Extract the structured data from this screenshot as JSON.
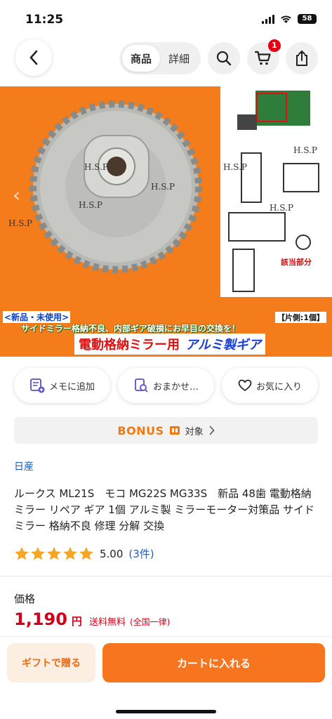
{
  "status": {
    "time": "11:25",
    "battery": "58"
  },
  "header": {
    "tabs": [
      {
        "label": "商品"
      },
      {
        "label": "詳細"
      }
    ],
    "cart_count": "1"
  },
  "hero": {
    "watermark": "H.S.P",
    "caption_new": "<新品・未使用>",
    "caption_quantity": "【片側:1個】",
    "caption_notice": "サイドミラー格納不良、内部ギア破損にお早目の交換を！",
    "title_main": "電動格納ミラー用",
    "title_sub": "アルミ製ギア",
    "label_part": "該当部分",
    "colors": {
      "background": "#f47c1a",
      "title_red": "#e01010",
      "title_blue": "#1a3fd8"
    }
  },
  "actions": [
    {
      "label": "メモに追加",
      "icon": "memo-add-icon"
    },
    {
      "label": "おまかせ…",
      "icon": "search-list-icon"
    },
    {
      "label": "お気に入り",
      "icon": "heart-icon"
    }
  ],
  "bonus": {
    "word": "BONUS",
    "target": "対象"
  },
  "product": {
    "brand": "日産",
    "title": "ルークス ML21S　モコ MG22S MG33S　新品 48歯 電動格納ミラー リペア ギア 1個 アルミ製  ミラーモーター対策品 サイドミラー 格納不良 修理 分解 交換",
    "rating": "5.00",
    "rating_stars": 5,
    "review_count": "(3件)"
  },
  "price": {
    "label": "価格",
    "amount": "1,190",
    "unit": "円",
    "shipping": "送料無料",
    "shipping_note": "(全国一律)"
  },
  "bottom": {
    "gift_label": "ギフトで贈る",
    "cart_label": "カートに入れる"
  }
}
